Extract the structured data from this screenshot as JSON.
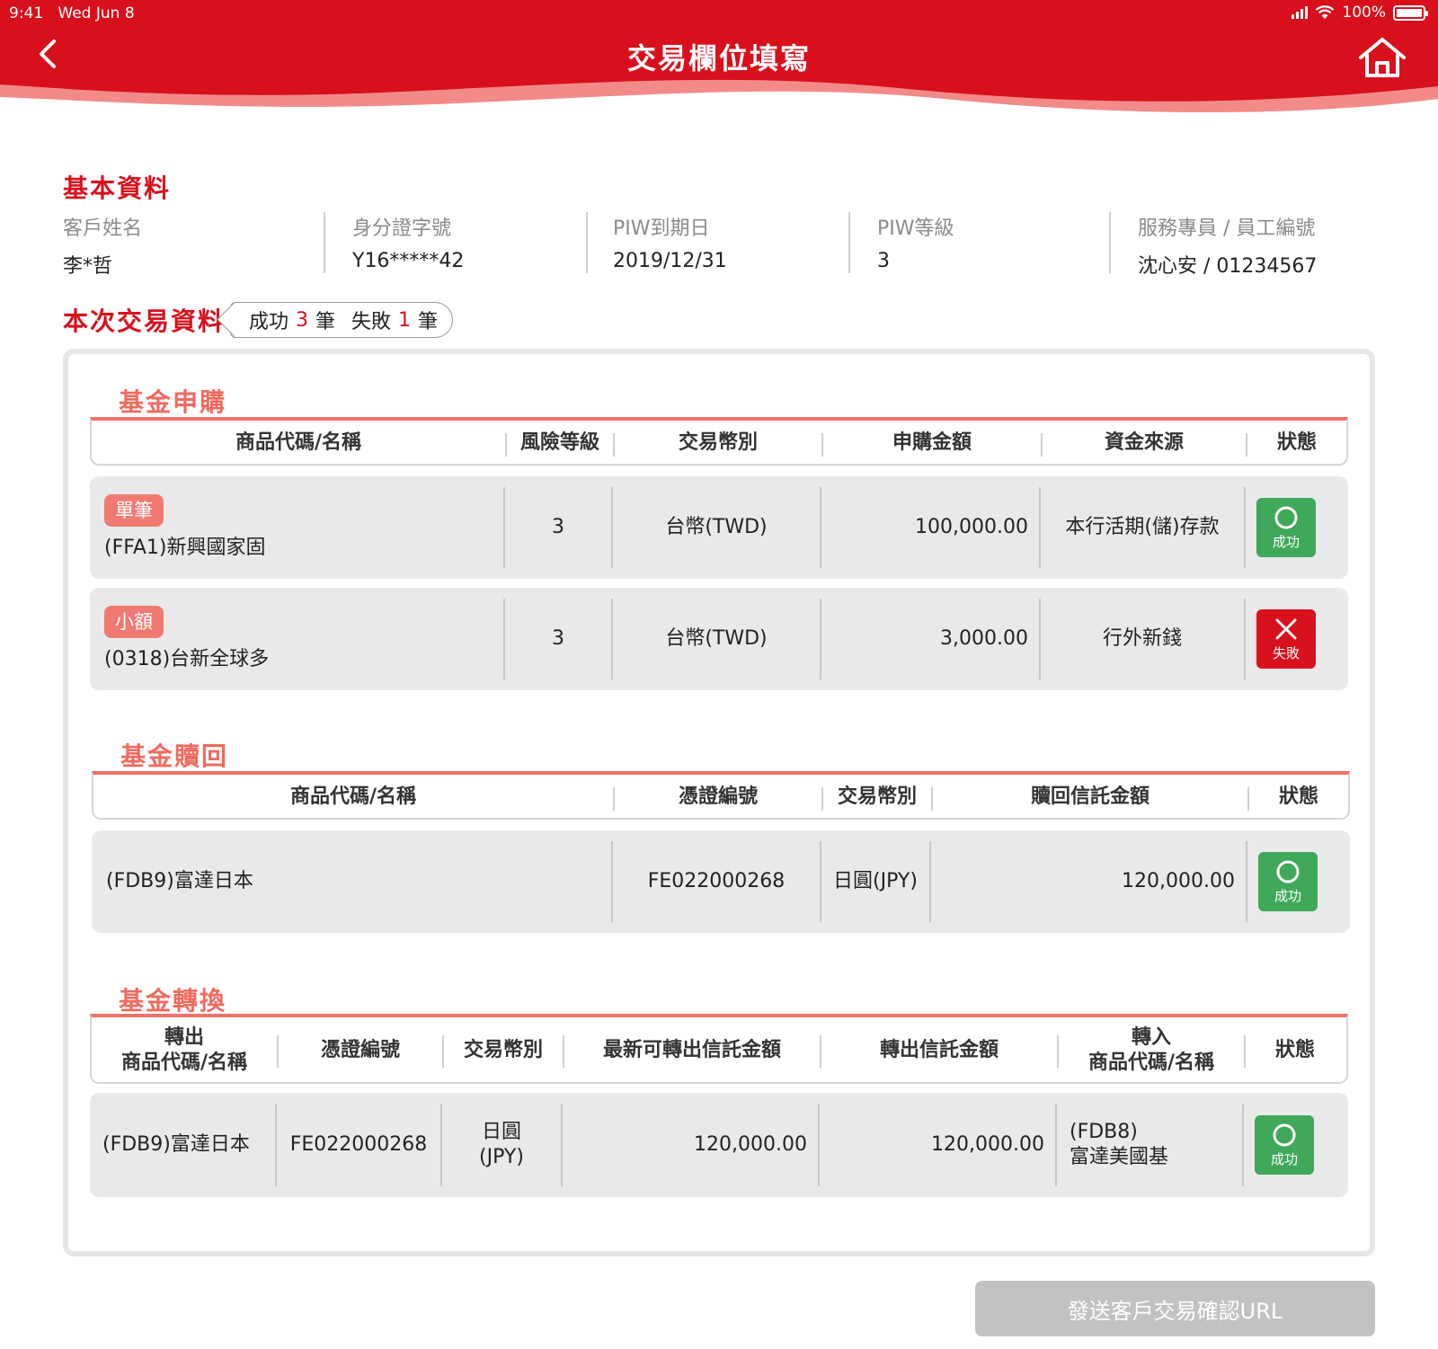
{
  "status_bar": {
    "time": "9:41",
    "date": "Wed Jun 8",
    "battery": "100%"
  },
  "header": {
    "title": "交易欄位填寫"
  },
  "basic_info": {
    "title": "基本資料",
    "fields": [
      {
        "label": "客戶姓名",
        "value": "李*哲"
      },
      {
        "label": "身分證字號",
        "value": "Y16*****42"
      },
      {
        "label": "PIW到期日",
        "value": "2019/12/31"
      },
      {
        "label": "PIW等級",
        "value": "3"
      },
      {
        "label": "服務專員 / 員工編號",
        "value": "沈心安 / 01234567"
      }
    ]
  },
  "transaction": {
    "title": "本次交易資料",
    "summary": {
      "success_label": "成功",
      "success_count": "3",
      "fail_label": "失敗",
      "fail_count": "1",
      "unit": "筆"
    }
  },
  "subscription": {
    "title": "基金申購",
    "headers": [
      "商品代碼/名稱",
      "風險等級",
      "交易幣別",
      "申購金額",
      "資金來源",
      "狀態"
    ],
    "rows": [
      {
        "tag": "單筆",
        "product": "(FFA1)新興國家固",
        "risk": "3",
        "currency": "台幣(TWD)",
        "amount": "100,000.00",
        "source": "本行活期(儲)存款",
        "status": "成功",
        "status_type": "success"
      },
      {
        "tag": "小額",
        "product": "(0318)台新全球多",
        "risk": "3",
        "currency": "台幣(TWD)",
        "amount": "3,000.00",
        "source": "行外新錢",
        "status": "失敗",
        "status_type": "fail"
      }
    ]
  },
  "redemption": {
    "title": "基金贖回",
    "headers": [
      "商品代碼/名稱",
      "憑證編號",
      "交易幣別",
      "贖回信託金額",
      "狀態"
    ],
    "rows": [
      {
        "product": "(FDB9)富達日本",
        "certificate": "FE022000268",
        "currency": "日圓(JPY)",
        "amount": "120,000.00",
        "status": "成功",
        "status_type": "success"
      }
    ]
  },
  "conversion": {
    "title": "基金轉換",
    "headers": {
      "out_product_1": "轉出",
      "out_product_2": "商品代碼/名稱",
      "certificate": "憑證編號",
      "currency": "交易幣別",
      "latest_amount": "最新可轉出信託金額",
      "out_amount": "轉出信託金額",
      "in_product_1": "轉入",
      "in_product_2": "商品代碼/名稱",
      "status": "狀態"
    },
    "rows": [
      {
        "out_product": "(FDB9)富達日本",
        "certificate": "FE022000268",
        "currency_1": "日圓",
        "currency_2": "(JPY)",
        "latest_amount": "120,000.00",
        "out_amount": "120,000.00",
        "in_product_1": "(FDB8)",
        "in_product_2": "富達美國基",
        "status": "成功",
        "status_type": "success"
      }
    ]
  },
  "actions": {
    "send_label": "發送客戶交易確認URL"
  },
  "colors": {
    "brand_red": "#d8101c",
    "accent_coral": "#f06a5e",
    "success_green": "#3fa85b",
    "disabled_gray": "#c2c2c2"
  }
}
